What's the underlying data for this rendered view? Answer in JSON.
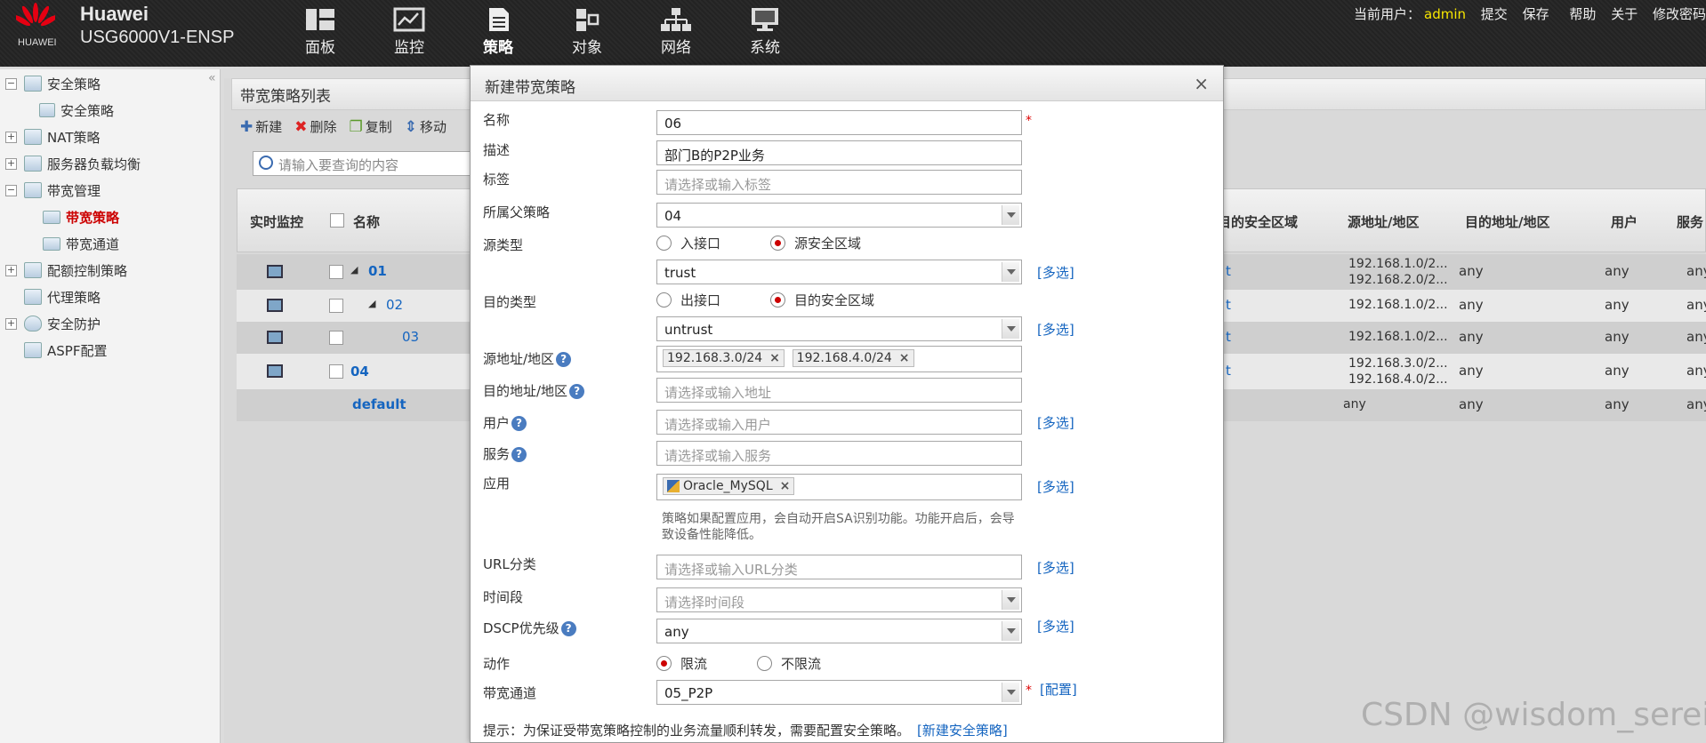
{
  "header": {
    "logo_text": "HUAWEI",
    "brand": "Huawei",
    "model": "USG6000V1-ENSP",
    "nav": [
      {
        "label": "面板",
        "icon": "dashboard-icon"
      },
      {
        "label": "监控",
        "icon": "monitor-icon"
      },
      {
        "label": "策略",
        "icon": "policy-icon"
      },
      {
        "label": "对象",
        "icon": "object-icon"
      },
      {
        "label": "网络",
        "icon": "network-icon"
      },
      {
        "label": "系统",
        "icon": "system-icon"
      }
    ],
    "active_nav": "策略",
    "current_user_label": "当前用户：",
    "current_user": "admin",
    "links": [
      "提交",
      "保存",
      "帮助",
      "关于",
      "修改密码"
    ]
  },
  "sidebar": {
    "items": [
      {
        "label": "安全策略",
        "toggle": "−"
      },
      {
        "label": "安全策略",
        "toggle": ""
      },
      {
        "label": "NAT策略",
        "toggle": "+"
      },
      {
        "label": "服务器负载均衡",
        "toggle": "+"
      },
      {
        "label": "带宽管理",
        "toggle": "−"
      },
      {
        "label": "带宽策略",
        "toggle": ""
      },
      {
        "label": "带宽通道",
        "toggle": ""
      },
      {
        "label": "配额控制策略",
        "toggle": "+"
      },
      {
        "label": "代理策略",
        "toggle": ""
      },
      {
        "label": "安全防护",
        "toggle": "+"
      },
      {
        "label": "ASPF配置",
        "toggle": ""
      }
    ],
    "selected": "带宽策略"
  },
  "main": {
    "title": "带宽策略列表",
    "toolbar": [
      "新建",
      "删除",
      "复制",
      "移动"
    ],
    "search_placeholder": "请输入要查询的内容",
    "columns": [
      "实时监控",
      "名称",
      "目的安全区域",
      "源地址/地区",
      "目的地址/地区",
      "用户",
      "服务"
    ],
    "rows": [
      {
        "name": "01",
        "dst_zone": "t",
        "src": [
          "192.168.1.0/2...",
          "192.168.2.0/2..."
        ],
        "dst": "any",
        "user": "any",
        "svc": "any"
      },
      {
        "name": "02",
        "dst_zone": "t",
        "src": [
          "192.168.1.0/2..."
        ],
        "dst": "any",
        "user": "any",
        "svc": "any"
      },
      {
        "name": "03",
        "dst_zone": "t",
        "src": [
          "192.168.1.0/2..."
        ],
        "dst": "any",
        "user": "any",
        "svc": "any"
      },
      {
        "name": "04",
        "dst_zone": "t",
        "src": [
          "192.168.3.0/2...",
          "192.168.4.0/2..."
        ],
        "dst": "any",
        "user": "any",
        "svc": "any"
      },
      {
        "name": "default",
        "dst_zone": "",
        "src": [
          "any"
        ],
        "dst": "any",
        "user": "any",
        "svc": "any"
      }
    ]
  },
  "dialog": {
    "title": "新建带宽策略",
    "close": "×",
    "fields": {
      "name": {
        "label": "名称",
        "value": "06"
      },
      "desc": {
        "label": "描述",
        "value": "部门B的P2P业务"
      },
      "tag": {
        "label": "标签",
        "placeholder": "请选择或输入标签"
      },
      "parent": {
        "label": "所属父策略",
        "value": "04"
      },
      "src_type": {
        "label": "源类型",
        "opt1": "入接口",
        "opt2": "源安全区域"
      },
      "src_zone": {
        "value": "trust"
      },
      "dst_type": {
        "label": "目的类型",
        "opt1": "出接口",
        "opt2": "目的安全区域"
      },
      "dst_zone": {
        "value": "untrust"
      },
      "src_addr": {
        "label": "源地址/地区",
        "tags": [
          "192.168.3.0/24",
          "192.168.4.0/24"
        ]
      },
      "dst_addr": {
        "label": "目的地址/地区",
        "placeholder": "请选择或输入地址"
      },
      "user": {
        "label": "用户",
        "placeholder": "请选择或输入用户"
      },
      "service": {
        "label": "服务",
        "placeholder": "请选择或输入服务"
      },
      "app": {
        "label": "应用",
        "tags": [
          "Oracle_MySQL"
        ]
      },
      "app_note": "策略如果配置应用，会自动开启SA识别功能。功能开启后，会导致设备性能降低。",
      "url": {
        "label": "URL分类",
        "placeholder": "请选择或输入URL分类"
      },
      "time": {
        "label": "时间段",
        "placeholder": "请选择时间段"
      },
      "dscp": {
        "label": "DSCP优先级",
        "value": "any"
      },
      "action": {
        "label": "动作",
        "opt1": "限流",
        "opt2": "不限流"
      },
      "channel": {
        "label": "带宽通道",
        "value": "05_P2P"
      }
    },
    "required_mark": "*",
    "multi_label": "[多选]",
    "config_label": "[配置]",
    "help_mark": "?",
    "hint": "提示：为保证受带宽策略控制的业务流量顺利转发，需要配置安全策略。",
    "hint_link": "[新建安全策略]"
  },
  "watermark": "CSDN @wisdom_serein"
}
